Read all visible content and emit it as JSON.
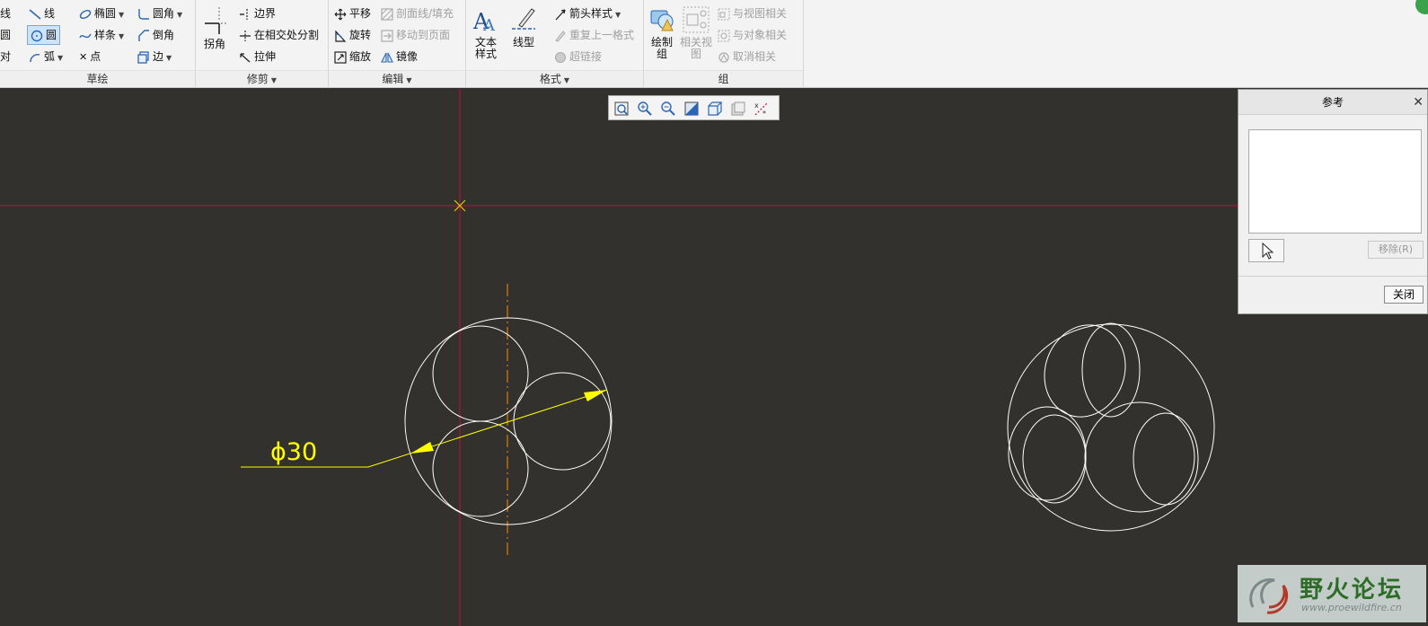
{
  "ribbon": {
    "sketch": {
      "items": {
        "line_partial": "线",
        "circle_partial": "圆",
        "sym_partial": "对",
        "line": "线",
        "circle": "圆",
        "arc": "弧",
        "ellipse": "椭圆",
        "spline": "样条",
        "point": "点",
        "fillet": "圆角",
        "chamfer": "倒角",
        "edge": "边"
      },
      "label": "草绘"
    },
    "trim": {
      "items": {
        "corner": "拐角",
        "boundary": "边界",
        "divide": "在相交处分割",
        "stretch": "拉伸"
      },
      "label": "修剪"
    },
    "edit": {
      "items": {
        "translate": "平移",
        "rotate": "旋转",
        "scale": "缩放",
        "hatch": "剖面线/填充",
        "move_page": "移动到页面",
        "mirror": "镜像"
      },
      "label": "编辑"
    },
    "format": {
      "items": {
        "text_style": "文本\n样式",
        "line_style": "线型",
        "arrow_style": "箭头样式",
        "repeat_format": "重复上一格式",
        "hyperlink": "超链接"
      },
      "label": "格式"
    },
    "group": {
      "items": {
        "draw_group": "绘制\n组",
        "related_view": "相关视\n图",
        "relate_view": "与视图相关",
        "relate_object": "与对象相关",
        "unrelate": "取消相关"
      },
      "label": "组"
    }
  },
  "drawing": {
    "dimension_text": "ϕ30",
    "colors": {
      "background": "#33312d",
      "geometry": "#ffffff",
      "dimension": "#ffff00",
      "datum": "#c0103a",
      "center": "#ff8c00"
    }
  },
  "ref_panel": {
    "title": "参考",
    "remove_label": "移除(R)",
    "close_label": "关闭"
  },
  "watermark": {
    "title": "野火论坛",
    "url": "www.proewildfire.cn"
  }
}
